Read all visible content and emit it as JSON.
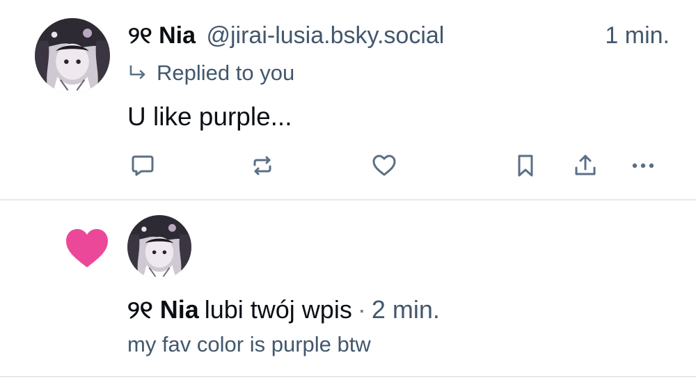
{
  "reply_notification": {
    "author_emoji": "୨୧",
    "author_name": "Nia",
    "handle": "@jirai-lusia.bsky.social",
    "time": "1 min.",
    "context_text": "Replied to you",
    "post_text": "U like purple...",
    "icons": {
      "context": "reply-arrow-icon",
      "actions": [
        "reply-icon",
        "repost-icon",
        "like-icon",
        "bookmark-icon",
        "share-icon",
        "more-icon"
      ]
    }
  },
  "like_notification": {
    "icon": "heart-filled-icon",
    "author_emoji": "୨୧",
    "author_name": "Nia",
    "action_text": "lubi twój wpis",
    "separator": "·",
    "time": "2 min.",
    "post_snippet": "my fav color is purple btw"
  },
  "colors": {
    "text": "#0b0f14",
    "secondary_text": "#42576c",
    "icon": "#5b6f85",
    "like_heart": "#ec4899",
    "divider": "#e6e9ee"
  }
}
